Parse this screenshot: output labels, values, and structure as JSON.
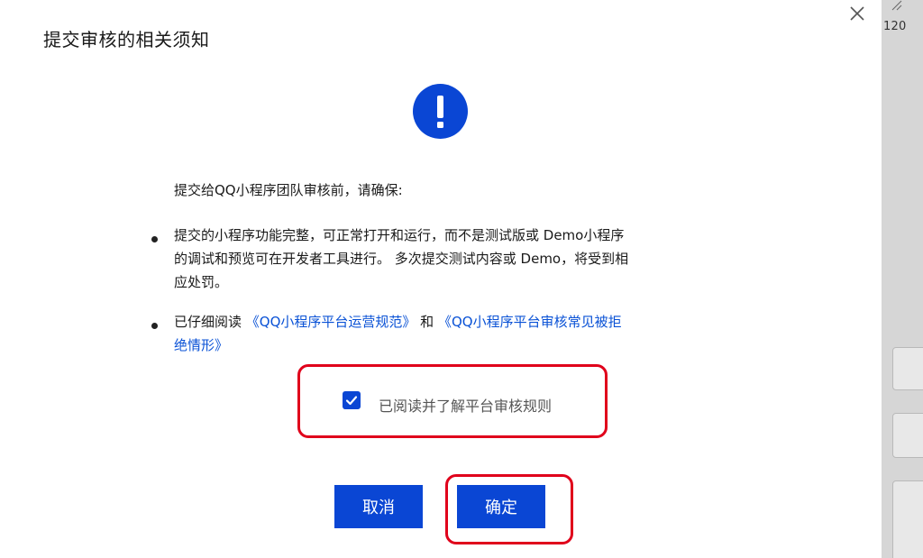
{
  "dialog": {
    "title": "提交审核的相关须知",
    "intro": "提交给QQ小程序团队审核前，请确保:",
    "items": [
      {
        "line1": "提交的小程序功能完整，可正常打开和运行，而不是测试版或 Demo小程序",
        "line2": "的调试和预览可在开发者工具进行。 多次提交测试内容或 Demo，将受到相",
        "line3": "应处罚。"
      },
      {
        "prefix": "已仔细阅读 ",
        "link1": "《QQ小程序平台运营规范》",
        "middle": " 和 ",
        "link2_part1": "《QQ小程序平台审核常见被拒",
        "link2_part2": "绝情形》"
      }
    ],
    "agree_label": "已阅读并了解平台审核规则",
    "agree_checked": true,
    "cancel_label": "取消",
    "confirm_label": "确定",
    "accent_color": "#0a46d4",
    "highlight_color": "#e0001b"
  },
  "background": {
    "partial_number": "120"
  },
  "icons": {
    "close": "close-icon",
    "warning": "exclamation-icon",
    "check": "check-icon"
  }
}
